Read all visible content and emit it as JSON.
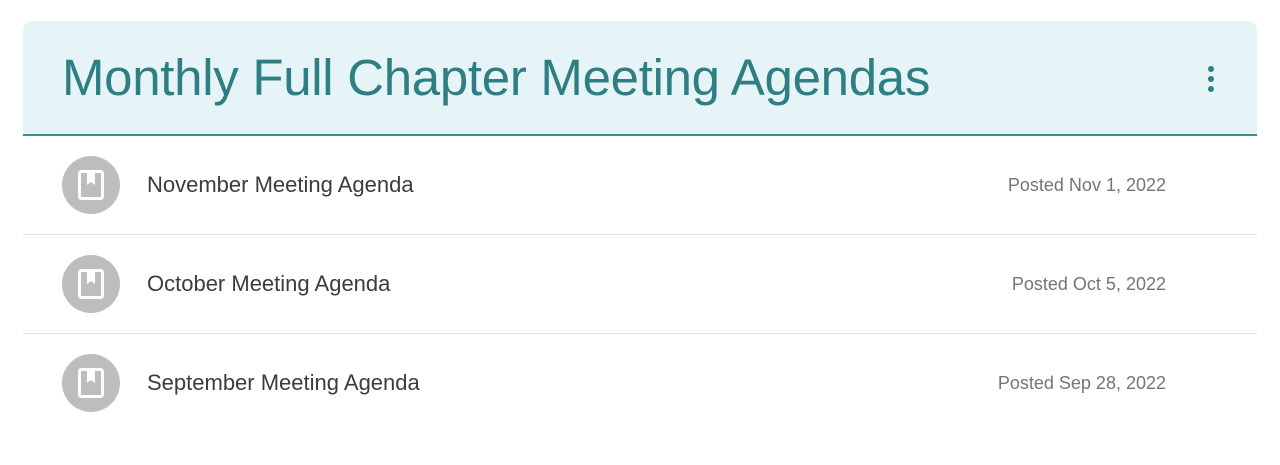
{
  "header": {
    "title": "Monthly Full Chapter Meeting Agendas",
    "more_icon": "more-vertical-icon"
  },
  "posts": [
    {
      "title": "November Meeting Agenda",
      "date": "Posted Nov 1, 2022",
      "icon": "bookmark-icon"
    },
    {
      "title": "October Meeting Agenda",
      "date": "Posted Oct 5, 2022",
      "icon": "bookmark-icon"
    },
    {
      "title": "September Meeting Agenda",
      "date": "Posted Sep 28, 2022",
      "icon": "bookmark-icon"
    }
  ],
  "colors": {
    "header_bg": "#e6f4f8",
    "accent": "#2e7f84",
    "avatar_bg": "#bdbdbd"
  }
}
